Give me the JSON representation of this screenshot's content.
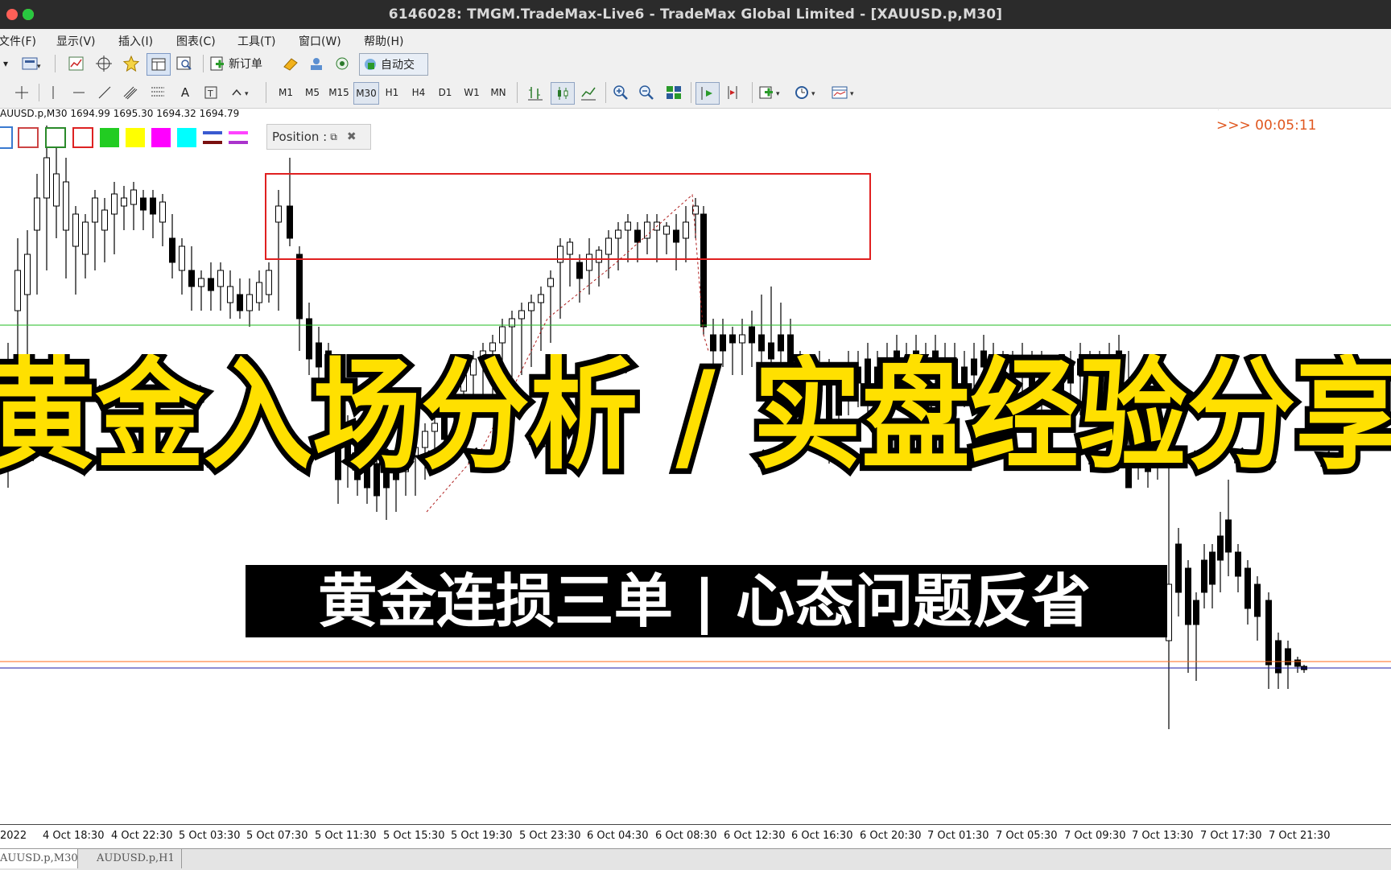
{
  "window": {
    "title": "6146028: TMGM.TradeMax-Live6 - TradeMax Global Limited - [XAUUSD.p,M30]",
    "dots": [
      "#ff5f57",
      "#febc2e",
      "#28c840"
    ]
  },
  "menu": [
    "文件(F)",
    "显示(V)",
    "插入(I)",
    "图表(C)",
    "工具(T)",
    "窗口(W)",
    "帮助(H)"
  ],
  "toolbar1": {
    "new_order": "新订单",
    "autotrade": "自动交"
  },
  "toolbar2": {
    "text_tool": "A",
    "timeframes": [
      "M1",
      "M5",
      "M15",
      "M30",
      "H1",
      "H4",
      "D1",
      "W1",
      "MN"
    ],
    "active_timeframe": "M30"
  },
  "chart": {
    "info": "AUUSD.p,M30  1694.99 1695.30 1694.32 1694.79",
    "position_panel": "Position :",
    "timer": ">>> 00:05:11",
    "swatches": [
      "#ffffff",
      "#ffffff",
      "#ffffff",
      "#ffffff",
      "#22cc22",
      "#ffff00",
      "#ff00ff",
      "#00ffff"
    ],
    "colors": {
      "red_box": "#e02020",
      "green_line": "#22bb22",
      "orange_line": "#ff6a1a",
      "blue_line": "#1a1aaa",
      "timer": "#e0571f"
    }
  },
  "overlay": {
    "headline": "黄金入场分析 / 实盘经验分享",
    "headline_color": "#ffe000",
    "subtitle": "黄金连损三单 | 心态问题反省"
  },
  "time_axis": [
    "2022",
    "4 Oct 18:30",
    "4 Oct 22:30",
    "5 Oct 03:30",
    "5 Oct 07:30",
    "5 Oct 11:30",
    "5 Oct 15:30",
    "5 Oct 19:30",
    "5 Oct 23:30",
    "6 Oct 04:30",
    "6 Oct 08:30",
    "6 Oct 12:30",
    "6 Oct 16:30",
    "6 Oct 20:30",
    "7 Oct 01:30",
    "7 Oct 05:30",
    "7 Oct 09:30",
    "7 Oct 13:30",
    "7 Oct 17:30",
    "7 Oct 21:30"
  ],
  "tabs": [
    "AUUSD.p,M30",
    "AUDUSD.p,H1"
  ]
}
